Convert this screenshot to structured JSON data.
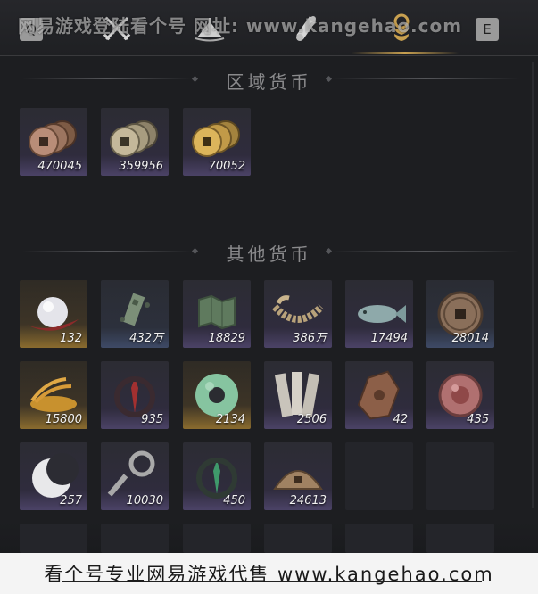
{
  "watermark": "网易游戏登陆看个号 网址: www.kangehao.com",
  "top_bar": {
    "left_key": "Q",
    "right_key": "E",
    "tabs": [
      {
        "icon": "crossed-swords-icon"
      },
      {
        "icon": "bamboo-hat-icon"
      },
      {
        "icon": "scroll-icon"
      },
      {
        "icon": "coin-stack-icon",
        "active": true
      }
    ]
  },
  "sections": {
    "regional_title": "区域货币",
    "other_title": "其他货币"
  },
  "regional_currencies": [
    {
      "icon": "copper-coins-icon",
      "amount": "470045"
    },
    {
      "icon": "silver-coins-icon",
      "amount": "359956"
    },
    {
      "icon": "gold-coins-icon",
      "amount": "70052"
    }
  ],
  "other_currencies": [
    {
      "icon": "pearl-icon",
      "amount": "132"
    },
    {
      "icon": "jade-token-icon",
      "amount": "432万"
    },
    {
      "icon": "map-scrap-icon",
      "amount": "18829"
    },
    {
      "icon": "coin-string-icon",
      "amount": "386万"
    },
    {
      "icon": "jade-fish-icon",
      "amount": "17494"
    },
    {
      "icon": "bronze-coin-icon",
      "amount": "28014"
    },
    {
      "icon": "grain-icon",
      "amount": "15800"
    },
    {
      "icon": "red-seal-icon",
      "amount": "935"
    },
    {
      "icon": "jade-ring-icon",
      "amount": "2134"
    },
    {
      "icon": "bamboo-slips-icon",
      "amount": "2506"
    },
    {
      "icon": "bronze-plaque-icon",
      "amount": "42"
    },
    {
      "icon": "red-stone-icon",
      "amount": "435"
    },
    {
      "icon": "crescent-icon",
      "amount": "257"
    },
    {
      "icon": "key-coin-icon",
      "amount": "10030"
    },
    {
      "icon": "green-seal-icon",
      "amount": "450"
    },
    {
      "icon": "half-coin-icon",
      "amount": "24613"
    }
  ],
  "footer": {
    "text": "看个号专业网易游戏代售 www.kangehao.com"
  },
  "colors": {
    "background": "#1d1e21",
    "tab_active": "#c8a050",
    "tile_purple": "#4b4266",
    "tile_gold": "#8a6b2e",
    "tile_blue": "#3e4a66"
  }
}
